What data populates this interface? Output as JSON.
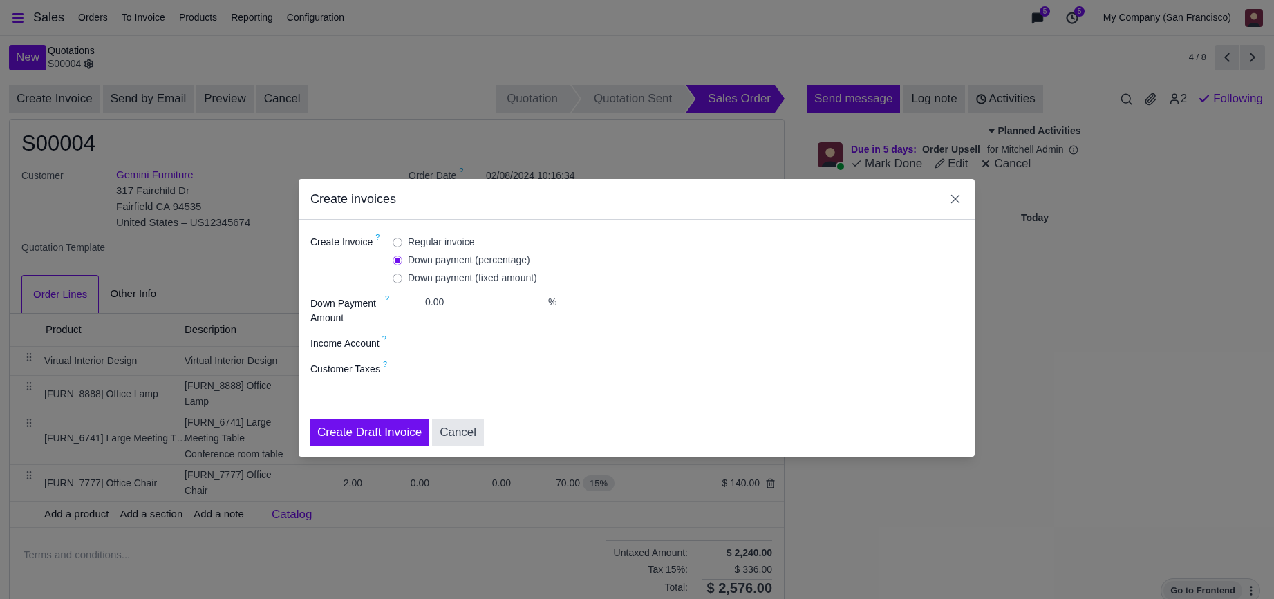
{
  "navbar": {
    "app": "Sales",
    "menu": [
      "Orders",
      "To Invoice",
      "Products",
      "Reporting",
      "Configuration"
    ],
    "messages_badge": "5",
    "activities_badge": "5",
    "company": "My Company (San Francisco)"
  },
  "breadcrumb": {
    "new_button": "New",
    "parent": "Quotations",
    "current": "S00004",
    "pager": "4 / 8"
  },
  "actions": [
    "Create Invoice",
    "Send by Email",
    "Preview",
    "Cancel"
  ],
  "stages": [
    {
      "label": "Quotation",
      "selected": false
    },
    {
      "label": "Quotation Sent",
      "selected": false
    },
    {
      "label": "Sales Order",
      "selected": true
    }
  ],
  "form": {
    "title": "S00004",
    "customer": {
      "label": "Customer",
      "name": "Gemini Furniture",
      "address": [
        "317 Fairchild Dr",
        "Fairfield CA 94535",
        "United States – US12345674"
      ]
    },
    "order_date": {
      "label": "Order Date",
      "help": "?",
      "value": "02/08/2024 10:16:34"
    },
    "quotation_template": {
      "label": "Quotation Template"
    },
    "tabs": [
      {
        "label": "Order Lines",
        "selected": true
      },
      {
        "label": "Other Info",
        "selected": false
      }
    ],
    "columns": [
      "Product",
      "Description"
    ],
    "rows": [
      {
        "product": "Virtual Interior Design",
        "description": "Virtual Interior Design"
      },
      {
        "product": "[FURN_8888] Office Lamp",
        "description": "[FURN_8888] Office Lamp"
      },
      {
        "product": "[FURN_6741] Large Meeting T…",
        "description": "[FURN_6741] Large Meeting Table Conference room table"
      },
      {
        "product": "[FURN_7777] Office Chair",
        "description": "[FURN_7777] Office Chair",
        "quantity": "2.00",
        "delivered": "0.00",
        "invoiced": "0.00",
        "unit_price": "70.00",
        "tax": "15%",
        "subtotal": "$ 140.00"
      }
    ],
    "add_links": [
      "Add a product",
      "Add a section",
      "Add a note"
    ],
    "catalog": "Catalog",
    "terms_placeholder": "Terms and conditions...",
    "totals": [
      {
        "label": "Untaxed Amount:",
        "value": "$ 2,240.00",
        "kind": "bold"
      },
      {
        "label": "Tax 15%:",
        "value": "$ 336.00",
        "kind": "plain"
      },
      {
        "label": "Total:",
        "value": "$ 2,576.00",
        "kind": "grand"
      }
    ]
  },
  "chatter": {
    "buttons": [
      {
        "label": "Send message",
        "selected": true
      },
      {
        "label": "Log note",
        "selected": false
      },
      {
        "label": "Activities",
        "selected": false
      }
    ],
    "followers": "2",
    "follow": "Following",
    "planned_header": "Planned Activities",
    "activity": {
      "due": "Due in 5 days:",
      "title": "Order Upsell",
      "assignee": "for Mitchell Admin",
      "actions": [
        {
          "kind": "done",
          "label": "Mark Done"
        },
        {
          "kind": "edit",
          "label": "Edit"
        },
        {
          "kind": "cancel",
          "label": "Cancel"
        }
      ]
    },
    "today": "Today"
  },
  "dialog": {
    "title": "Create invoices",
    "fields": [
      {
        "kind": "radio",
        "label": "Create Invoice",
        "help": "?",
        "options": [
          {
            "label": "Regular invoice",
            "selected": false
          },
          {
            "label": "Down payment (percentage)",
            "selected": true
          },
          {
            "label": "Down payment (fixed amount)",
            "selected": false
          }
        ]
      },
      {
        "kind": "amount",
        "label": "Down Payment Amount",
        "help": "?",
        "value": "0.00",
        "unit": "%"
      },
      {
        "kind": "empty",
        "label": "Income Account",
        "help": "?"
      },
      {
        "kind": "empty",
        "label": "Customer Taxes",
        "help": "?"
      }
    ],
    "buttons": [
      {
        "label": "Create Draft Invoice",
        "kind": "primary"
      },
      {
        "label": "Cancel",
        "kind": "secondary"
      }
    ]
  },
  "frontend_button": "Go to Frontend"
}
